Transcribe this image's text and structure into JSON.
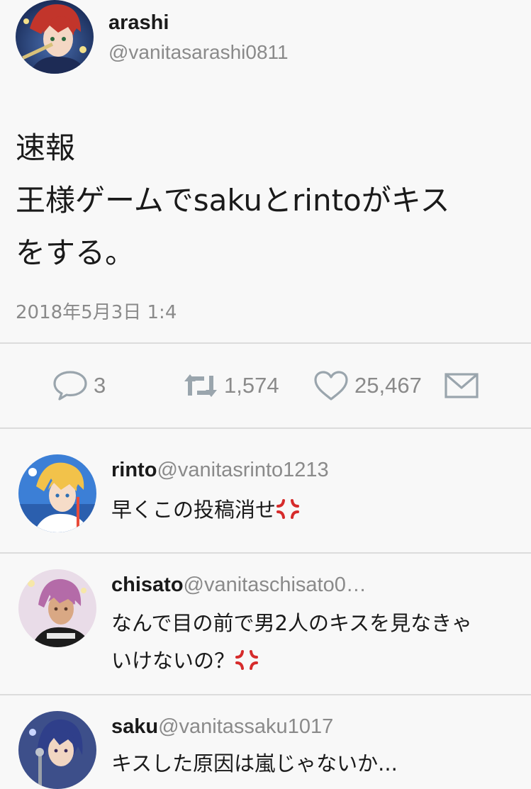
{
  "tweet": {
    "author_name": "arashi",
    "author_handle": "@vanitasarashi0811",
    "lines": [
      "速報",
      "王様ゲームでsakuとrintoがキス",
      "をする。"
    ],
    "timestamp": "2018年5月3日 1:4"
  },
  "actions": {
    "reply_count": "3",
    "retweet_count": "1,574",
    "like_count": "25,467"
  },
  "icons": {
    "reply": "speech-bubble-icon",
    "retweet": "retweet-arrows-icon",
    "like": "heart-icon",
    "dm": "envelope-icon",
    "anger": "anger-symbol-emoji"
  },
  "colors": {
    "background": "#f8f8f8",
    "text": "#1a1a1a",
    "muted": "#8a8a8a",
    "divider": "#dcdcdc",
    "action_icon": "#9aa5ad",
    "anger_emoji": "#d62b2b"
  },
  "replies": [
    {
      "name": "rinto",
      "handle": "@vanitasrinto1213",
      "line1": "早くこの投稿消せ",
      "line2": ""
    },
    {
      "name": "chisato",
      "handle": "@vanitaschisato0…",
      "line1": "なんで目の前で男2人のキスを見なきゃ",
      "line2": "いけないの？"
    },
    {
      "name": "saku",
      "handle": "@vanitassaku1017",
      "line1": "キスした原因は嵐じゃないか...",
      "line2": ""
    }
  ]
}
